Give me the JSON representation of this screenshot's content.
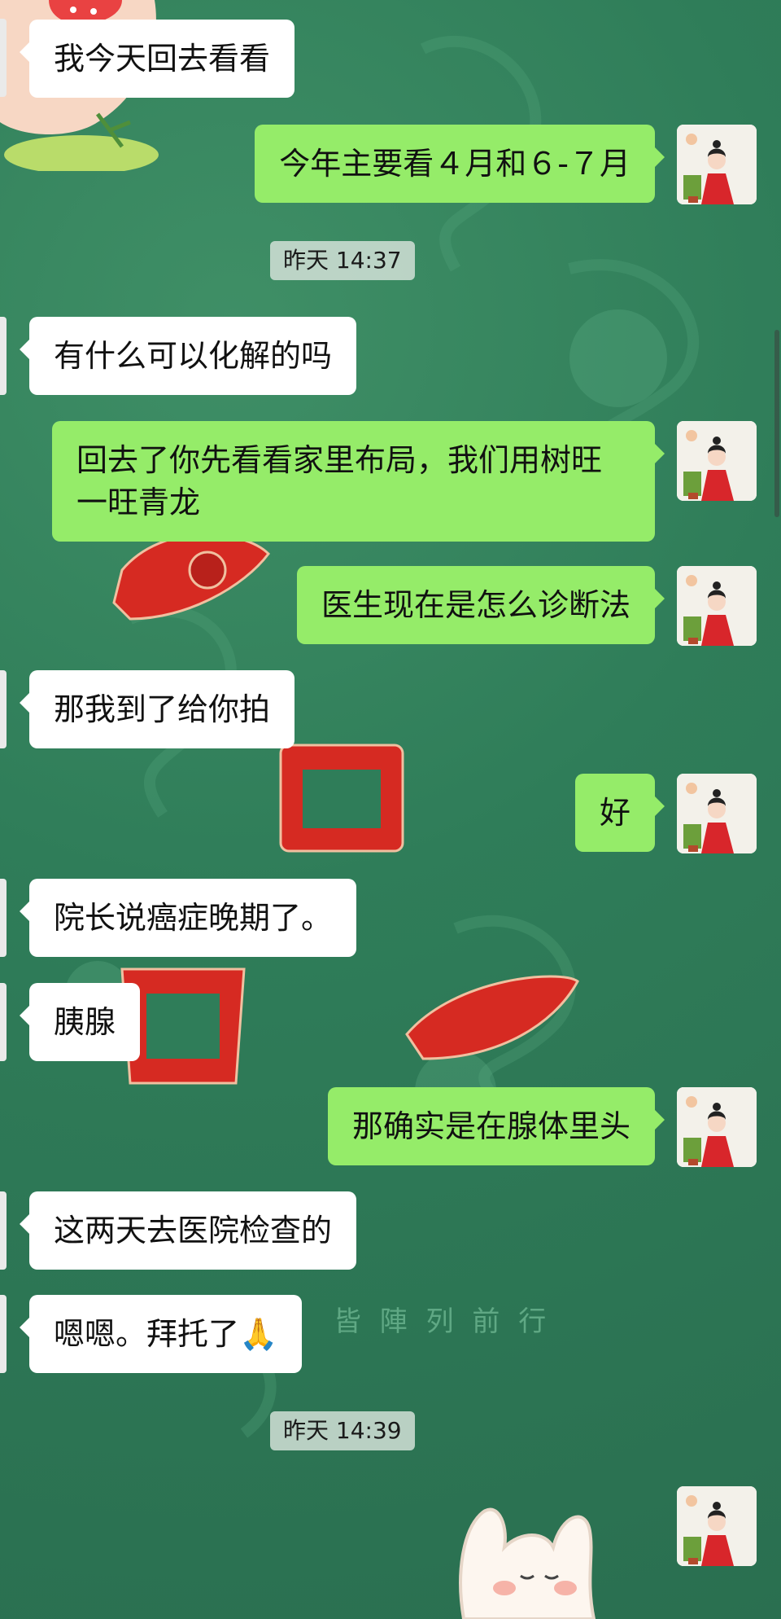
{
  "colors": {
    "incoming_bubble": "#ffffff",
    "outgoing_bubble": "#95ec69",
    "background": "#2f7d59"
  },
  "wallpaper": {
    "text": "皆 陣 列 前 行"
  },
  "messages": [
    {
      "dir": "in",
      "text": "我今天回去看看"
    },
    {
      "dir": "out",
      "text": "今年主要看４月和６-７月"
    },
    {
      "type": "time",
      "text": "昨天 14:37"
    },
    {
      "dir": "in",
      "text": "有什么可以化解的吗"
    },
    {
      "dir": "out",
      "text": "回去了你先看看家里布局，我们用树旺一旺青龙"
    },
    {
      "dir": "out",
      "text": "医生现在是怎么诊断法"
    },
    {
      "dir": "in",
      "text": "那我到了给你拍"
    },
    {
      "dir": "out",
      "text": "好"
    },
    {
      "dir": "in",
      "text": "院长说癌症晚期了。"
    },
    {
      "dir": "in",
      "text": "胰腺"
    },
    {
      "dir": "out",
      "text": "那确实是在腺体里头"
    },
    {
      "dir": "in",
      "text": "这两天去医院检查的"
    },
    {
      "dir": "in",
      "text": "嗯嗯。拜托了🙏"
    },
    {
      "type": "time",
      "text": "昨天 14:39"
    }
  ]
}
